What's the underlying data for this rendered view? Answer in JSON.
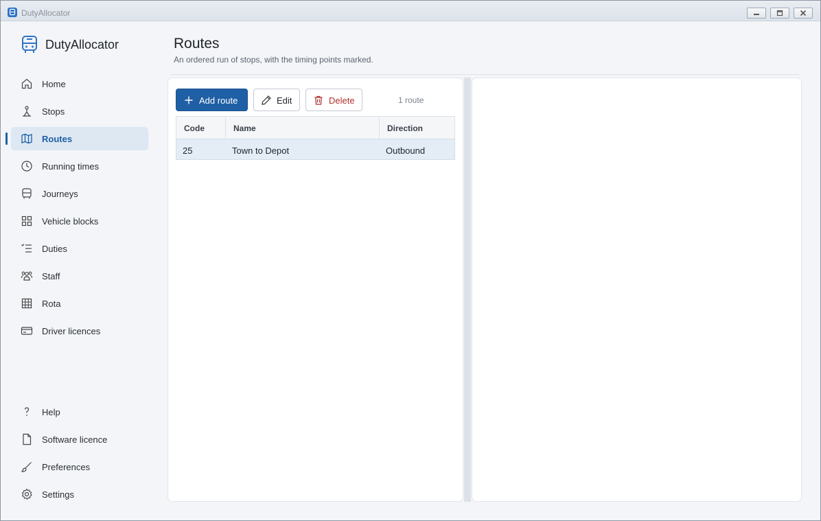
{
  "window": {
    "title": "DutyAllocator"
  },
  "sidebar": {
    "brand": "DutyAllocator",
    "items": [
      {
        "label": "Home",
        "icon": "home-icon"
      },
      {
        "label": "Stops",
        "icon": "stop-icon"
      },
      {
        "label": "Routes",
        "icon": "map-icon",
        "active": true
      },
      {
        "label": "Running times",
        "icon": "clock-icon"
      },
      {
        "label": "Journeys",
        "icon": "bus-icon"
      },
      {
        "label": "Vehicle blocks",
        "icon": "grid-icon"
      },
      {
        "label": "Duties",
        "icon": "checklist-icon"
      },
      {
        "label": "Staff",
        "icon": "people-icon"
      },
      {
        "label": "Rota",
        "icon": "table-icon"
      },
      {
        "label": "Driver licences",
        "icon": "card-icon"
      }
    ],
    "footer_items": [
      {
        "label": "Help",
        "icon": "question-icon"
      },
      {
        "label": "Software licence",
        "icon": "document-icon"
      },
      {
        "label": "Preferences",
        "icon": "brush-icon"
      },
      {
        "label": "Settings",
        "icon": "gear-icon"
      }
    ]
  },
  "page": {
    "title": "Routes",
    "subtitle": "An ordered run of stops, with the timing points marked."
  },
  "toolbar": {
    "add_label": "Add route",
    "edit_label": "Edit",
    "delete_label": "Delete",
    "count": "1 route"
  },
  "table": {
    "columns": [
      "Code",
      "Name",
      "Direction"
    ],
    "rows": [
      {
        "code": "25",
        "name": "Town to Depot",
        "direction": "Outbound",
        "selected": true
      }
    ]
  },
  "colors": {
    "accent": "#1f5fa5",
    "danger": "#b0302c",
    "selected_row": "#e4edf6"
  }
}
